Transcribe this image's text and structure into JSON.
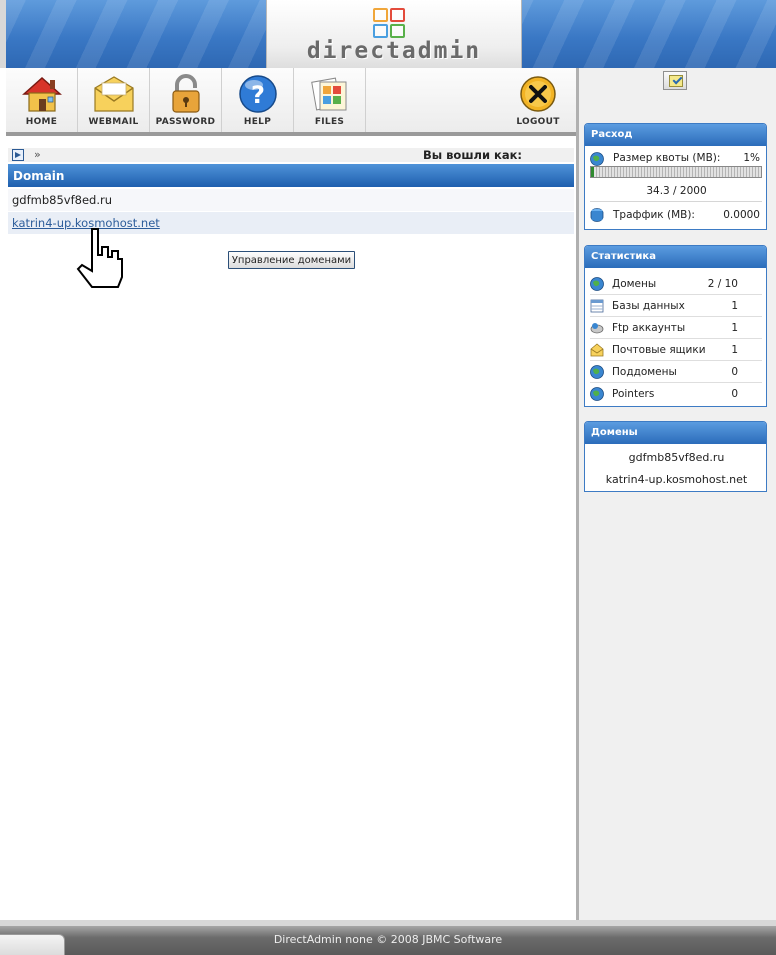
{
  "header": {
    "logo_text": "directadmin"
  },
  "toolbar": {
    "home": "HOME",
    "webmail": "WEBMAIL",
    "password": "PASSWORD",
    "help": "HELP",
    "files": "FILES",
    "logout": "LOGOUT"
  },
  "main": {
    "breadcrumb_sep": "»",
    "logged_in_as": "Вы вошли как:",
    "table_header": "Domain",
    "domains": [
      {
        "name": "gdfmb85vf8ed.ru",
        "link": false
      },
      {
        "name": "katrin4-up.kosmohost.net",
        "link": true
      }
    ],
    "manage_button": "Управление доменами"
  },
  "sidebar": {
    "usage": {
      "title": "Расход",
      "quota_label": "Размер квоты (MB):",
      "quota_percent": "1%",
      "quota_fraction": 0.017,
      "quota_value": "34.3 / 2000",
      "traffic_label": "Траффик (MB):",
      "traffic_value": "0.0000"
    },
    "stats": {
      "title": "Статистика",
      "rows": [
        {
          "label": "Домены",
          "value": "2 / 10",
          "icon": "globe-icon"
        },
        {
          "label": "Базы данных",
          "value": "1",
          "icon": "database-table-icon"
        },
        {
          "label": "Ftp аккаунты",
          "value": "1",
          "icon": "ftp-drive-icon"
        },
        {
          "label": "Почтовые ящики",
          "value": "1",
          "icon": "mailbox-icon"
        },
        {
          "label": "Поддомены",
          "value": "0",
          "icon": "globe-icon"
        },
        {
          "label": "Pointers",
          "value": "0",
          "icon": "globe-icon"
        }
      ]
    },
    "domains": {
      "title": "Домены",
      "items": [
        "gdfmb85vf8ed.ru",
        "katrin4-up.kosmohost.net"
      ]
    }
  },
  "footer": {
    "text": "DirectAdmin none © 2008 JBMC Software"
  },
  "colors": {
    "header_blue": "#3a78c5",
    "panel_blue": "#2b6cba",
    "link_blue": "#2d5d9b",
    "footer_gray": "#5a5a5a"
  }
}
